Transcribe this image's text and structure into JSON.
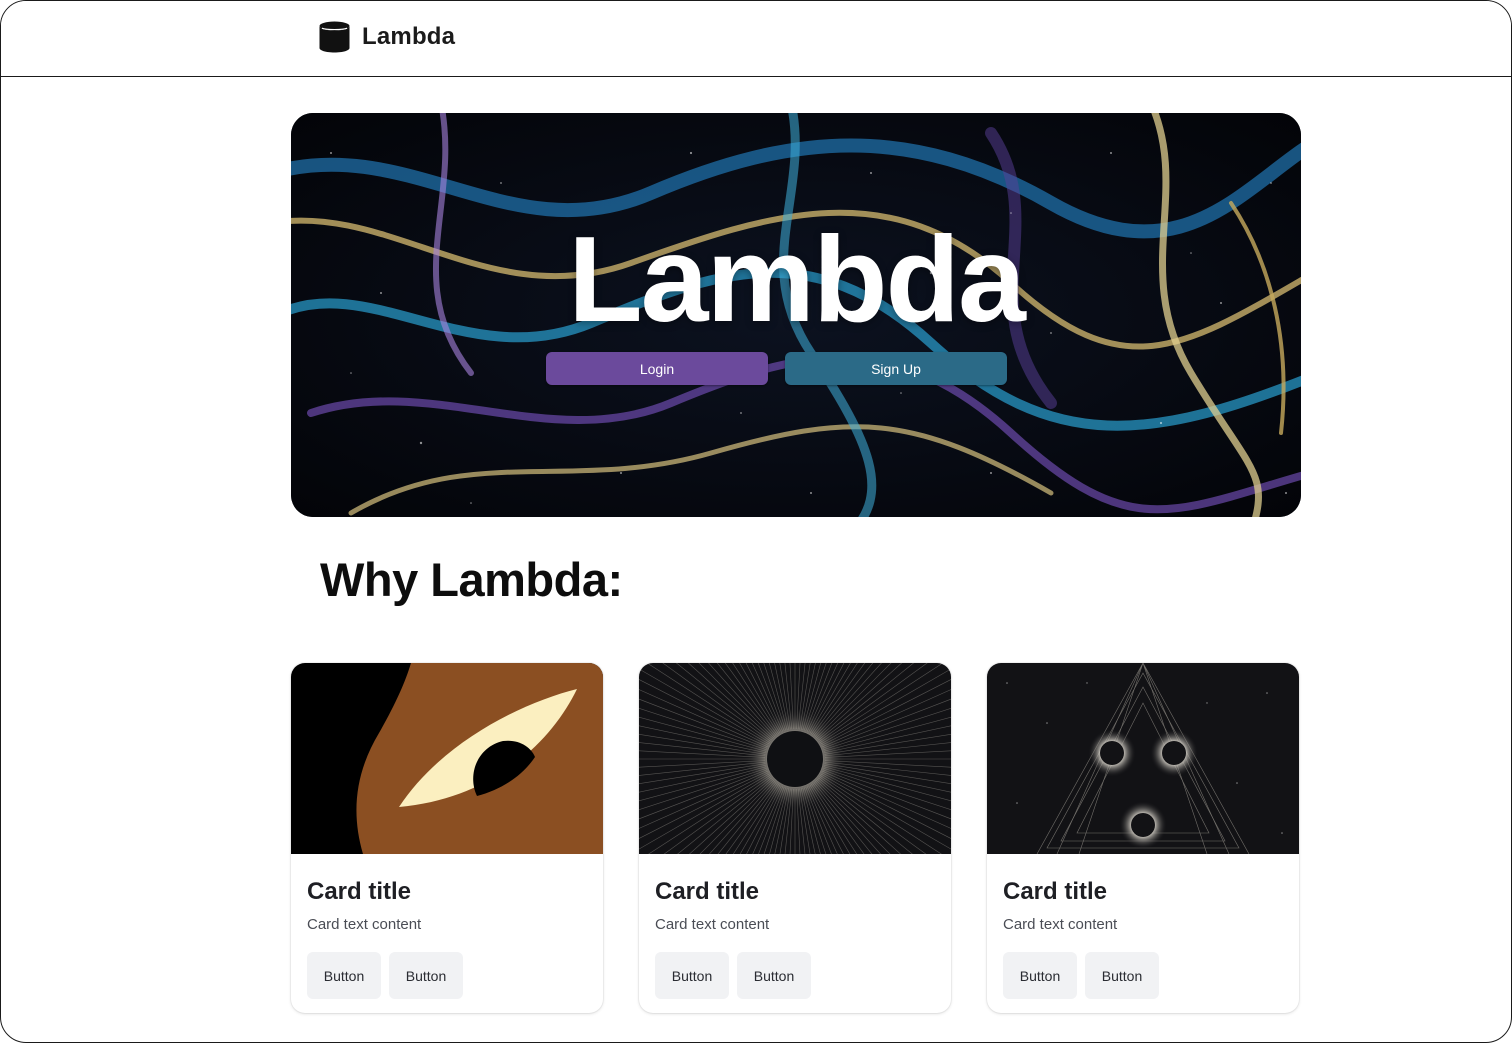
{
  "header": {
    "brand_name": "Lambda",
    "brand_icon": "database-icon"
  },
  "hero": {
    "title": "Lambda",
    "login_label": "Login",
    "signup_label": "Sign Up",
    "login_color": "#6b4a9c",
    "signup_color": "#2b6a87"
  },
  "section": {
    "heading": "Why Lambda:"
  },
  "cards": [
    {
      "title": "Card title",
      "text": "Card text content",
      "button_1": "Button",
      "button_2": "Button"
    },
    {
      "title": "Card title",
      "text": "Card text content",
      "button_1": "Button",
      "button_2": "Button"
    },
    {
      "title": "Card title",
      "text": "Card text content",
      "button_1": "Button",
      "button_2": "Button"
    }
  ]
}
